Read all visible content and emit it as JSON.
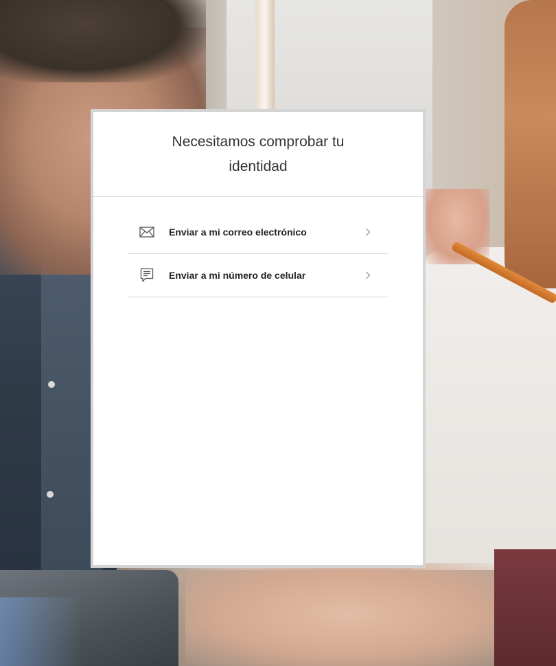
{
  "modal": {
    "title": "Necesitamos comprobar tu identidad"
  },
  "options": [
    {
      "label": "Enviar a mi correo electrónico",
      "icon": "envelope-icon"
    },
    {
      "label": "Enviar a mi número de celular",
      "icon": "chat-message-icon"
    }
  ],
  "colors": {
    "modal_border": "#d4d4d4",
    "divider": "#d6d6d6",
    "title_text": "#333333",
    "option_text": "#222222",
    "icon_stroke": "#555555"
  }
}
